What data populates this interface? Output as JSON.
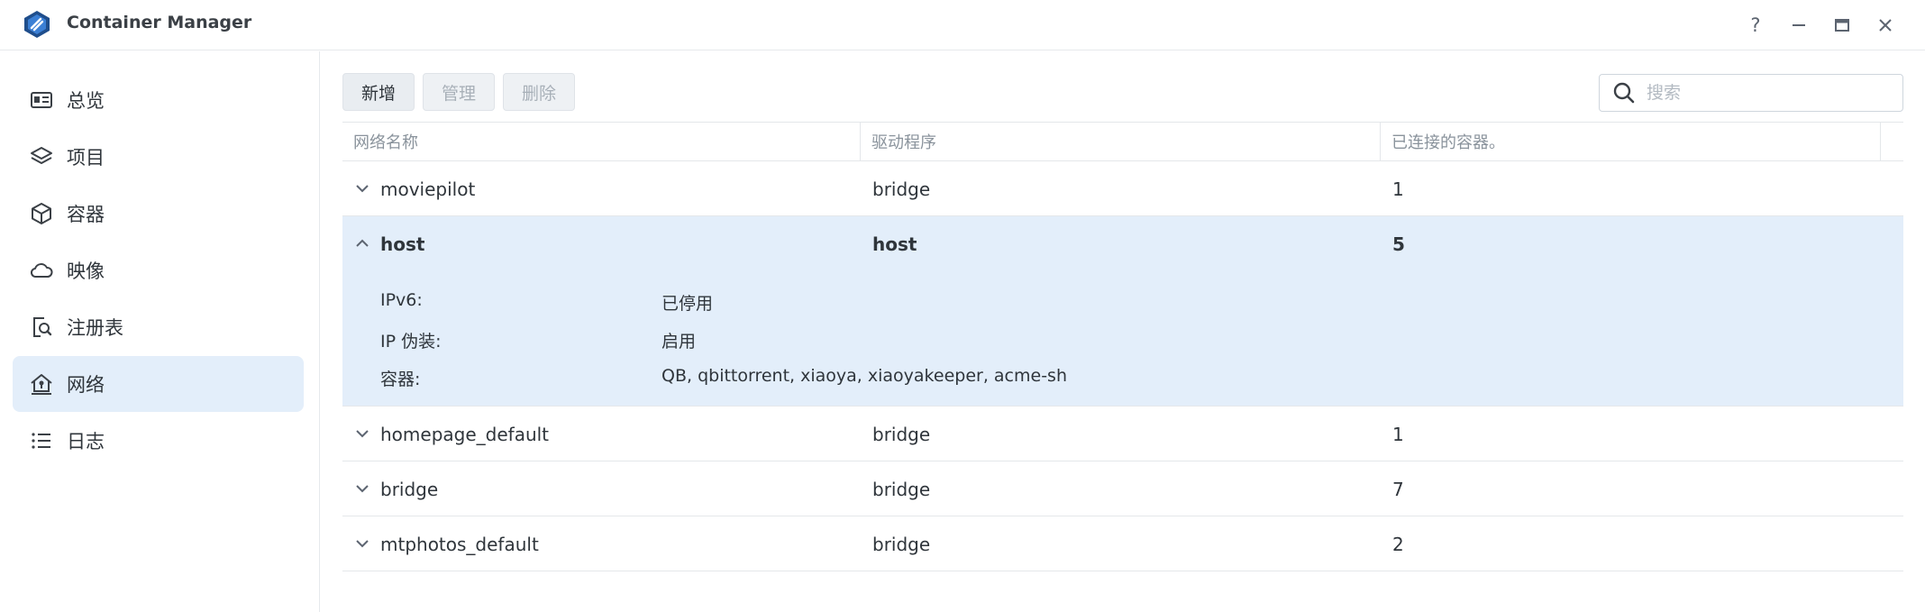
{
  "app": {
    "title": "Container Manager"
  },
  "window_controls": {
    "help": "?"
  },
  "sidebar": {
    "items": [
      {
        "label": "总览",
        "icon": "overview-icon"
      },
      {
        "label": "项目",
        "icon": "layers-icon"
      },
      {
        "label": "容器",
        "icon": "cube-icon"
      },
      {
        "label": "映像",
        "icon": "cloud-icon"
      },
      {
        "label": "注册表",
        "icon": "registry-search-icon"
      },
      {
        "label": "网络",
        "icon": "network-home-icon",
        "active": true
      },
      {
        "label": "日志",
        "icon": "list-icon"
      }
    ]
  },
  "toolbar": {
    "add_label": "新增",
    "manage_label": "管理",
    "delete_label": "删除"
  },
  "search": {
    "placeholder": "搜索",
    "value": ""
  },
  "table": {
    "columns": [
      "网络名称",
      "驱动程序",
      "已连接的容器。"
    ],
    "rows": [
      {
        "name": "moviepilot",
        "driver": "bridge",
        "count": "1",
        "expanded": false
      },
      {
        "name": "host",
        "driver": "host",
        "count": "5",
        "expanded": true,
        "details": [
          {
            "label": "IPv6:",
            "value": "已停用"
          },
          {
            "label": "IP 伪装:",
            "value": "启用"
          },
          {
            "label": "容器:",
            "value": "QB, qbittorrent, xiaoya, xiaoyakeeper, acme-sh"
          }
        ]
      },
      {
        "name": "homepage_default",
        "driver": "bridge",
        "count": "1",
        "expanded": false
      },
      {
        "name": "bridge",
        "driver": "bridge",
        "count": "7",
        "expanded": false
      },
      {
        "name": "mtphotos_default",
        "driver": "bridge",
        "count": "2",
        "expanded": false
      }
    ]
  },
  "colors": {
    "accent": "#e3eefa",
    "border": "#e4e7ea",
    "text": "#2f353b"
  }
}
